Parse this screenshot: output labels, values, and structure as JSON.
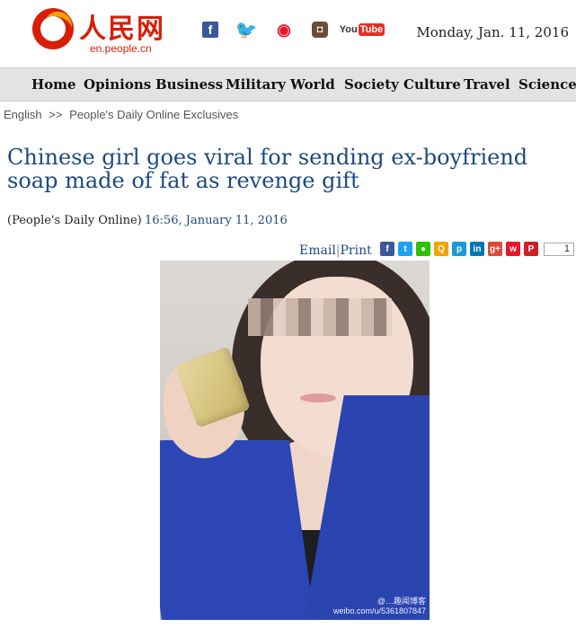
{
  "site": {
    "logo_cn": "人民网",
    "logo_en": "en.people.cn"
  },
  "social": [
    {
      "name": "facebook-icon",
      "glyph": "f"
    },
    {
      "name": "twitter-icon",
      "glyph": "🐦"
    },
    {
      "name": "weibo-icon",
      "glyph": "◉"
    },
    {
      "name": "instagram-icon",
      "glyph": "◘"
    },
    {
      "name": "youtube-icon",
      "glyph": "You",
      "suffix": "Tube"
    }
  ],
  "date": "Monday, Jan. 11, 2016",
  "nav": [
    "Home",
    "Opinions",
    "Business",
    "Military",
    "World",
    "Society",
    "Culture",
    "Travel",
    "Science"
  ],
  "breadcrumb": {
    "root": "English",
    "separator": ">>",
    "section": "People's Daily Online Exclusives"
  },
  "article": {
    "title": "Chinese girl goes viral for sending ex-boyfriend soap made of fat as revenge gift",
    "source": "(People's Daily Online)",
    "timestamp": "16:56, January 11, 2016",
    "email_label": "Email",
    "print_label": "Print",
    "share_count": "1"
  },
  "share_icons": [
    {
      "name": "facebook-share-icon",
      "color": "#3b5998",
      "glyph": "f"
    },
    {
      "name": "twitter-share-icon",
      "color": "#1da1f2",
      "glyph": "t"
    },
    {
      "name": "wechat-share-icon",
      "color": "#2dc100",
      "glyph": "●"
    },
    {
      "name": "qzone-share-icon",
      "color": "#f0a300",
      "glyph": "Q"
    },
    {
      "name": "pinterest-alt-share-icon",
      "color": "#1c9ad6",
      "glyph": "p"
    },
    {
      "name": "linkedin-share-icon",
      "color": "#0077b5",
      "glyph": "in"
    },
    {
      "name": "googleplus-share-icon",
      "color": "#dd4b39",
      "glyph": "g+"
    },
    {
      "name": "weibo-share-icon",
      "color": "#e6162d",
      "glyph": "w"
    },
    {
      "name": "pinterest-share-icon",
      "color": "#cb2027",
      "glyph": "P"
    }
  ],
  "photo": {
    "watermark_line1": "@…趣闻博客",
    "watermark_line2": "weibo.com/u/5361807847"
  },
  "colors": {
    "title": "#1d4a7e",
    "nav_bg": "#e3e3e3",
    "brand_red": "#d81e06"
  }
}
